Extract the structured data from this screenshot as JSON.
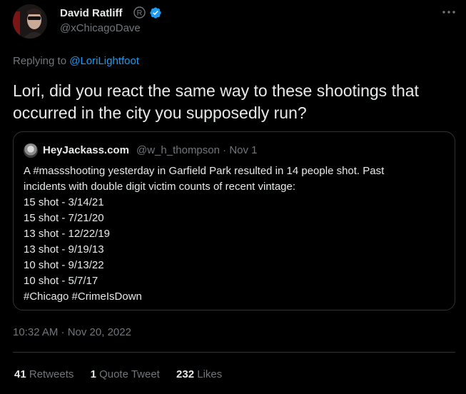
{
  "author": {
    "name": "David Ratliff",
    "handle": "@xChicagoDave"
  },
  "reply": {
    "prefix": "Replying to ",
    "mention": "@LoriLightfoot"
  },
  "tweet": {
    "text": "Lori, did you react the same way to these shootings that occurred in the city you supposedly run?"
  },
  "quote": {
    "name": "HeyJackass.com",
    "handle": "@w_h_thompson",
    "separator": "·",
    "date": "Nov 1",
    "lines": [
      "A #massshooting yesterday in Garfield Park resulted in 14 people shot. Past",
      "incidents with double digit victim counts of recent vintage:",
      "15 shot - 3/14/21",
      "15 shot - 7/21/20",
      "13 shot - 12/22/19",
      "13 shot - 9/19/13",
      "10 shot - 9/13/22",
      "10 shot - 5/7/17",
      "#Chicago #CrimeIsDown"
    ]
  },
  "timestamp": "10:32 AM · Nov 20, 2022",
  "stats": {
    "retweets_count": "41",
    "retweets_label": " Retweets",
    "quotes_count": "1",
    "quotes_label": " Quote Tweet",
    "likes_count": "232",
    "likes_label": " Likes"
  },
  "colors": {
    "background": "#000000",
    "text": "#e7e9ea",
    "secondary": "#71767b",
    "accent": "#1d9bf0",
    "border": "#2f3336"
  },
  "icons": {
    "registered": "registered-icon",
    "verified": "verified-badge-icon",
    "more": "more-horizontal-icon"
  }
}
